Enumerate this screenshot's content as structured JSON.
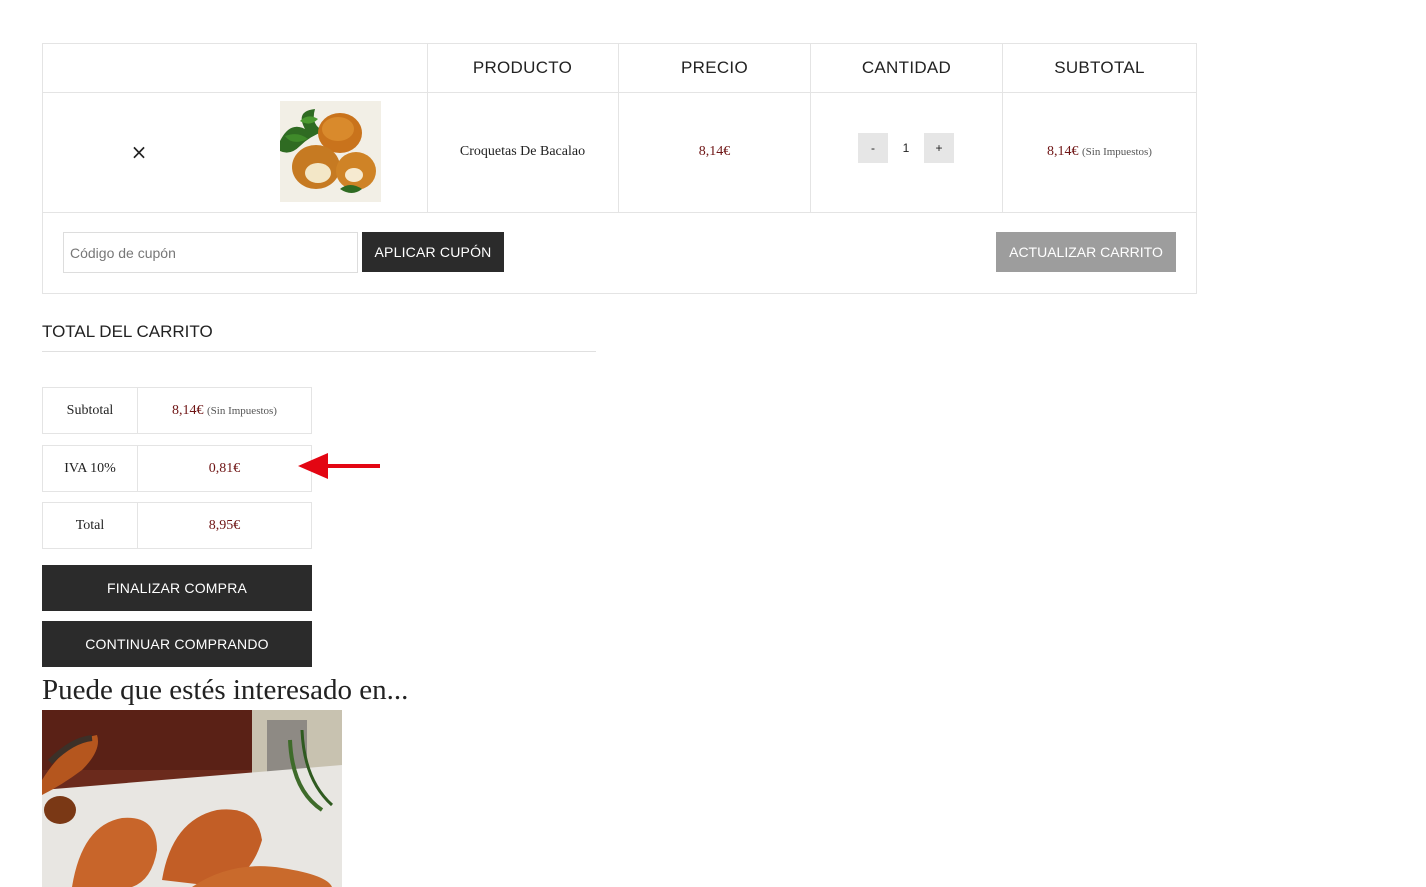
{
  "cart": {
    "headers": {
      "product": "PRODUCTO",
      "price": "PRECIO",
      "quantity": "CANTIDAD",
      "subtotal": "SUBTOTAL"
    },
    "items": [
      {
        "name": "Croquetas De Bacalao",
        "price": "8,14€",
        "quantity": "1",
        "subtotal": "8,14€",
        "subtotal_note": "(Sin Impuestos)",
        "remove_icon": "close-icon",
        "image": "product-thumbnail"
      }
    ],
    "qty_minus": "-",
    "qty_plus": "+",
    "remove_symbol": "×",
    "coupon_placeholder": "Código de cupón",
    "apply_coupon_label": "APLICAR CUPÓN",
    "update_cart_label": "ACTUALIZAR CARRITO"
  },
  "totals": {
    "title": "TOTAL DEL CARRITO",
    "rows": [
      {
        "label": "Subtotal",
        "value": "8,14€",
        "note": "(Sin Impuestos)"
      },
      {
        "label": "IVA 10%",
        "value": "0,81€"
      },
      {
        "label": "Total",
        "value": "8,95€"
      }
    ],
    "checkout_label": "FINALIZAR COMPRA",
    "continue_label": "CONTINUAR COMPRANDO"
  },
  "related": {
    "heading": "Puede que estés interesado en..."
  },
  "colors": {
    "price": "#6e1414",
    "dark_button": "#2b2b2b",
    "update_button": "#9d9d9d",
    "annotation_arrow": "#e30613"
  }
}
